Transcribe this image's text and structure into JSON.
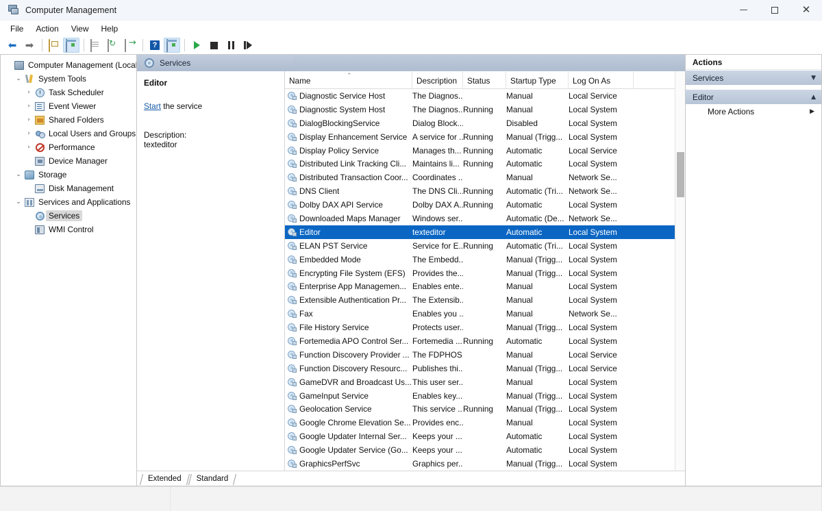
{
  "window": {
    "title": "Computer Management",
    "icon": "computer-management-icon",
    "buttons": {
      "minimize": "—",
      "maximize": "□",
      "close": "✕"
    }
  },
  "menubar": {
    "items": [
      "File",
      "Action",
      "View",
      "Help"
    ]
  },
  "toolbar": {
    "items": [
      {
        "name": "back-icon",
        "glyph": "⬅"
      },
      {
        "name": "forward-icon",
        "glyph": "➡"
      },
      {
        "name": "up-folder-icon"
      },
      {
        "name": "show-hide-console-tree-icon"
      },
      {
        "name": "properties-icon"
      },
      {
        "name": "refresh-icon"
      },
      {
        "name": "export-list-icon"
      },
      {
        "name": "help-icon",
        "glyph": "?"
      },
      {
        "name": "show-hide-action-pane-icon"
      },
      {
        "name": "start-service-icon"
      },
      {
        "name": "stop-service-icon"
      },
      {
        "name": "pause-service-icon"
      },
      {
        "name": "restart-service-icon"
      }
    ]
  },
  "tree": {
    "nodes": [
      {
        "label": "Computer Management (Local)",
        "indent": 0,
        "twist": "",
        "icon": "computer-management-icon",
        "selected": false
      },
      {
        "label": "System Tools",
        "indent": 1,
        "twist": "⌄",
        "icon": "system-tools-icon",
        "selected": false
      },
      {
        "label": "Task Scheduler",
        "indent": 2,
        "twist": "›",
        "icon": "task-scheduler-icon",
        "selected": false
      },
      {
        "label": "Event Viewer",
        "indent": 2,
        "twist": "›",
        "icon": "event-viewer-icon",
        "selected": false
      },
      {
        "label": "Shared Folders",
        "indent": 2,
        "twist": "›",
        "icon": "shared-folders-icon",
        "selected": false
      },
      {
        "label": "Local Users and Groups",
        "indent": 2,
        "twist": "›",
        "icon": "local-users-groups-icon",
        "selected": false
      },
      {
        "label": "Performance",
        "indent": 2,
        "twist": "›",
        "icon": "performance-icon",
        "selected": false
      },
      {
        "label": "Device Manager",
        "indent": 2,
        "twist": "",
        "icon": "device-manager-icon",
        "selected": false
      },
      {
        "label": "Storage",
        "indent": 1,
        "twist": "⌄",
        "icon": "storage-icon",
        "selected": false
      },
      {
        "label": "Disk Management",
        "indent": 2,
        "twist": "",
        "icon": "disk-management-icon",
        "selected": false
      },
      {
        "label": "Services and Applications",
        "indent": 1,
        "twist": "⌄",
        "icon": "services-applications-icon",
        "selected": false
      },
      {
        "label": "Services",
        "indent": 2,
        "twist": "",
        "icon": "services-icon",
        "selected": true
      },
      {
        "label": "WMI Control",
        "indent": 2,
        "twist": "",
        "icon": "wmi-control-icon",
        "selected": false
      }
    ]
  },
  "center": {
    "header_title": "Services",
    "header_icon": "services-icon"
  },
  "detail": {
    "service_name": "Editor",
    "action_link": "Start",
    "action_suffix": " the service",
    "description_label": "Description:",
    "description_text": "texteditor"
  },
  "list": {
    "columns": [
      "Name",
      "Description",
      "Status",
      "Startup Type",
      "Log On As"
    ],
    "sort_indicator": "⌃",
    "sort_column": "Name",
    "rows": [
      {
        "name": "Diagnostic Service Host",
        "description": "The Diagnos...",
        "status": "",
        "startup": "Manual",
        "logon": "Local Service",
        "selected": false
      },
      {
        "name": "Diagnostic System Host",
        "description": "The Diagnos...",
        "status": "Running",
        "startup": "Manual",
        "logon": "Local System",
        "selected": false
      },
      {
        "name": "DialogBlockingService",
        "description": "Dialog Block...",
        "status": "",
        "startup": "Disabled",
        "logon": "Local System",
        "selected": false
      },
      {
        "name": "Display Enhancement Service",
        "description": "A service for ...",
        "status": "Running",
        "startup": "Manual (Trigg...",
        "logon": "Local System",
        "selected": false
      },
      {
        "name": "Display Policy Service",
        "description": "Manages th...",
        "status": "Running",
        "startup": "Automatic",
        "logon": "Local Service",
        "selected": false
      },
      {
        "name": "Distributed Link Tracking Cli...",
        "description": "Maintains li...",
        "status": "Running",
        "startup": "Automatic",
        "logon": "Local System",
        "selected": false
      },
      {
        "name": "Distributed Transaction Coor...",
        "description": "Coordinates ...",
        "status": "",
        "startup": "Manual",
        "logon": "Network Se...",
        "selected": false
      },
      {
        "name": "DNS Client",
        "description": "The DNS Cli...",
        "status": "Running",
        "startup": "Automatic (Tri...",
        "logon": "Network Se...",
        "selected": false
      },
      {
        "name": "Dolby DAX API Service",
        "description": "Dolby DAX A...",
        "status": "Running",
        "startup": "Automatic",
        "logon": "Local System",
        "selected": false
      },
      {
        "name": "Downloaded Maps Manager",
        "description": "Windows ser...",
        "status": "",
        "startup": "Automatic (De...",
        "logon": "Network Se...",
        "selected": false
      },
      {
        "name": "Editor",
        "description": "texteditor",
        "status": "",
        "startup": "Automatic",
        "logon": "Local System",
        "selected": true
      },
      {
        "name": "ELAN PST Service",
        "description": "Service for E...",
        "status": "Running",
        "startup": "Automatic (Tri...",
        "logon": "Local System",
        "selected": false
      },
      {
        "name": "Embedded Mode",
        "description": "The Embedd...",
        "status": "",
        "startup": "Manual (Trigg...",
        "logon": "Local System",
        "selected": false
      },
      {
        "name": "Encrypting File System (EFS)",
        "description": "Provides the...",
        "status": "",
        "startup": "Manual (Trigg...",
        "logon": "Local System",
        "selected": false
      },
      {
        "name": "Enterprise App Managemen...",
        "description": "Enables ente...",
        "status": "",
        "startup": "Manual",
        "logon": "Local System",
        "selected": false
      },
      {
        "name": "Extensible Authentication Pr...",
        "description": "The Extensib...",
        "status": "",
        "startup": "Manual",
        "logon": "Local System",
        "selected": false
      },
      {
        "name": "Fax",
        "description": "Enables you ...",
        "status": "",
        "startup": "Manual",
        "logon": "Network Se...",
        "selected": false
      },
      {
        "name": "File History Service",
        "description": "Protects user...",
        "status": "",
        "startup": "Manual (Trigg...",
        "logon": "Local System",
        "selected": false
      },
      {
        "name": "Fortemedia APO Control Ser...",
        "description": "Fortemedia ...",
        "status": "Running",
        "startup": "Automatic",
        "logon": "Local System",
        "selected": false
      },
      {
        "name": "Function Discovery Provider ...",
        "description": "The FDPHOS...",
        "status": "",
        "startup": "Manual",
        "logon": "Local Service",
        "selected": false
      },
      {
        "name": "Function Discovery Resourc...",
        "description": "Publishes thi...",
        "status": "",
        "startup": "Manual (Trigg...",
        "logon": "Local Service",
        "selected": false
      },
      {
        "name": "GameDVR and Broadcast Us...",
        "description": "This user ser...",
        "status": "",
        "startup": "Manual",
        "logon": "Local System",
        "selected": false
      },
      {
        "name": "GameInput Service",
        "description": "Enables key...",
        "status": "",
        "startup": "Manual (Trigg...",
        "logon": "Local System",
        "selected": false
      },
      {
        "name": "Geolocation Service",
        "description": "This service ...",
        "status": "Running",
        "startup": "Manual (Trigg...",
        "logon": "Local System",
        "selected": false
      },
      {
        "name": "Google Chrome Elevation Se...",
        "description": "Provides enc...",
        "status": "",
        "startup": "Manual",
        "logon": "Local System",
        "selected": false
      },
      {
        "name": "Google Updater Internal Ser...",
        "description": "Keeps your ...",
        "status": "",
        "startup": "Automatic",
        "logon": "Local System",
        "selected": false
      },
      {
        "name": "Google Updater Service (Go...",
        "description": "Keeps your ...",
        "status": "",
        "startup": "Automatic",
        "logon": "Local System",
        "selected": false
      },
      {
        "name": "GraphicsPerfSvc",
        "description": "Graphics per...",
        "status": "",
        "startup": "Manual (Trigg...",
        "logon": "Local System",
        "selected": false
      }
    ]
  },
  "bottom_tabs": {
    "tabs": [
      {
        "label": "Extended",
        "active": true
      },
      {
        "label": "Standard",
        "active": false
      }
    ]
  },
  "actions": {
    "title": "Actions",
    "sections": [
      {
        "label": "Services",
        "chevron": "▼",
        "items": []
      },
      {
        "label": "Editor",
        "chevron": "▲",
        "items": [
          {
            "label": "More Actions",
            "arrow": "▶"
          }
        ]
      }
    ]
  },
  "colors": {
    "selection_blue": "#0b66c3",
    "header_bar": "#b7c4d6",
    "link_blue": "#1559a8",
    "window_chrome": "#f3f6fb"
  }
}
